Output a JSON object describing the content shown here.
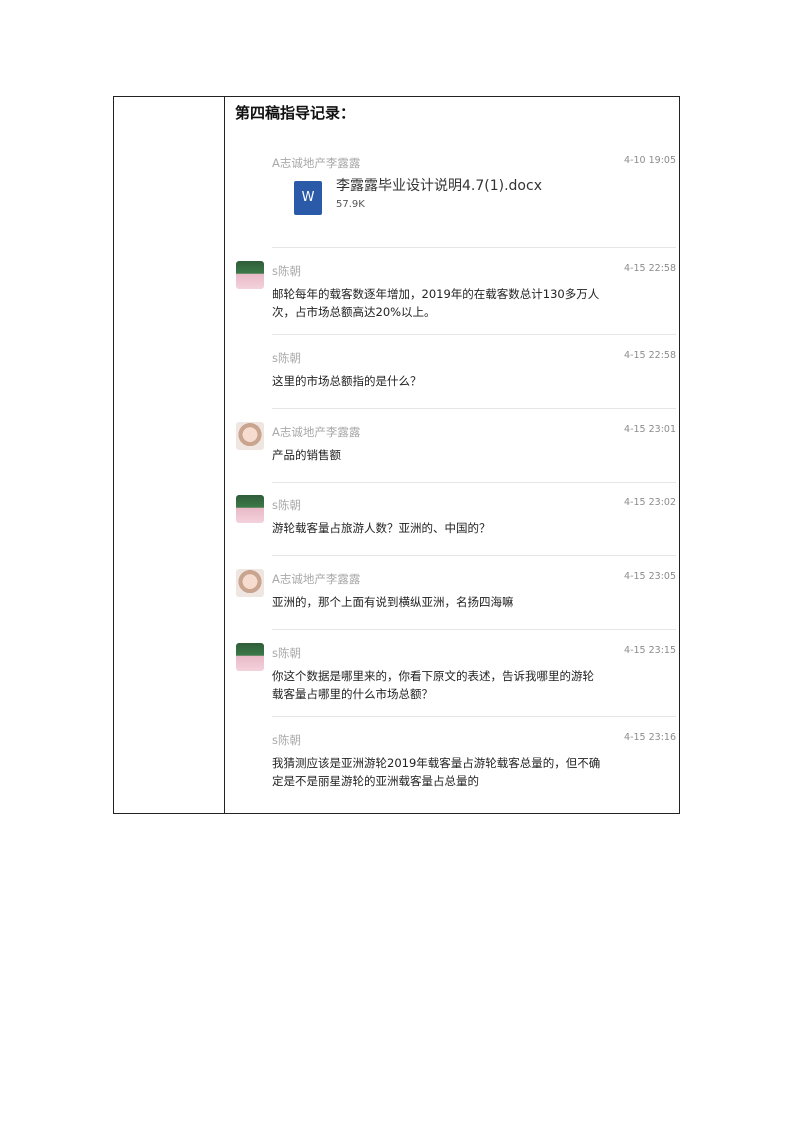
{
  "heading": "第四稿指导记录：",
  "file_message": {
    "sender": "A志诚地产李露露",
    "time": "4-10 19:05",
    "file_icon_letter": "W",
    "file_name": "李露露毕业设计说明4.7(1).docx",
    "file_size": "57.9K"
  },
  "messages": [
    {
      "sender": "s陈朝",
      "time": "4-15 22:58",
      "avatar": "boy",
      "lines": [
        "邮轮每年的载客数逐年增加，2019年的在载客数总计130多万人",
        "次，占市场总额高达20%以上。"
      ]
    },
    {
      "sender": "s陈朝",
      "time": "4-15 22:58",
      "avatar": "",
      "lines": [
        "这里的市场总额指的是什么？"
      ]
    },
    {
      "sender": "A志诚地产李露露",
      "time": "4-15 23:01",
      "avatar": "girl",
      "lines": [
        "产品的销售额"
      ]
    },
    {
      "sender": "s陈朝",
      "time": "4-15 23:02",
      "avatar": "boy",
      "lines": [
        "游轮载客量占旅游人数？亚洲的、中国的？"
      ]
    },
    {
      "sender": "A志诚地产李露露",
      "time": "4-15 23:05",
      "avatar": "girl",
      "lines": [
        "亚洲的，那个上面有说到横纵亚洲，名扬四海嘛"
      ]
    },
    {
      "sender": "s陈朝",
      "time": "4-15 23:15",
      "avatar": "boy",
      "lines": [
        "你这个数据是哪里来的，你看下原文的表述，告诉我哪里的游轮",
        "载客量占哪里的什么市场总额？"
      ]
    },
    {
      "sender": "s陈朝",
      "time": "4-15 23:16",
      "avatar": "",
      "lines": [
        "我猜测应该是亚洲游轮2019年载客量占游轮载客总量的，但不确",
        "定是不是丽星游轮的亚洲载客量占总量的"
      ]
    }
  ]
}
